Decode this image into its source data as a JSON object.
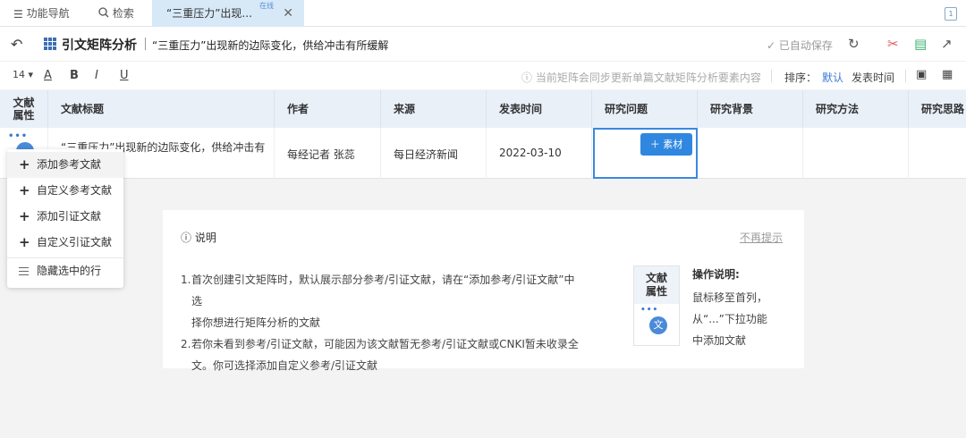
{
  "tabbar": {
    "nav_label": "功能导航",
    "search_label": "检索",
    "doc_tab_label": "“三重压力”出现...",
    "doc_tab_badge": "在线",
    "right_icon": "1"
  },
  "titlebar": {
    "app_name": "引文矩阵分析",
    "doc_title": "“三重压力”出现新的边际变化，供给冲击有所缓解",
    "autosave": "已自动保存"
  },
  "toolbar": {
    "font_size": "14",
    "notice": "当前矩阵会同步更新单篇文献矩阵分析要素内容",
    "sort_label": "排序：",
    "sort_default": "默认",
    "sort_time": "发表时间"
  },
  "table": {
    "headers": {
      "attr_line1": "文献",
      "attr_line2": "属性",
      "title": "文献标题",
      "author": "作者",
      "source": "来源",
      "date": "发表时间",
      "question": "研究问题",
      "background": "研究背景",
      "method": "研究方法",
      "idea": "研究思路"
    },
    "row": {
      "title": "“三重压力”出现新的边际变化，供给冲击有",
      "author": "每经记者 张蕊",
      "source": "每日经济新闻",
      "date": "2022-03-10"
    },
    "material_button": "素材"
  },
  "menu": {
    "items": [
      "添加参考文献",
      "自定义参考文献",
      "添加引证文献",
      "自定义引证文献"
    ],
    "hide_label": "隐藏选中的行"
  },
  "panel": {
    "title": "说明",
    "dismiss": "不再提示",
    "list": [
      {
        "num": "1.",
        "line1": "首次创建引文矩阵时，默认展示部分参考/引证文献，请在“添加参考/引证文献”中选",
        "line2": "择你想进行矩阵分析的文献"
      },
      {
        "num": "2.",
        "line1": "若你未看到参考/引证文献，可能因为该文献暂无参考/引证文献或CNKI暂未收录全",
        "line2": "文。你可选择添加自定义参考/引证文献"
      }
    ],
    "mini_line1": "文献",
    "mini_line2": "属性",
    "mini_avatar": "文",
    "op_title": "操作说明:",
    "op_lines": [
      "鼠标移至首列，",
      "从“...”下拉功能",
      "中添加文献"
    ]
  }
}
